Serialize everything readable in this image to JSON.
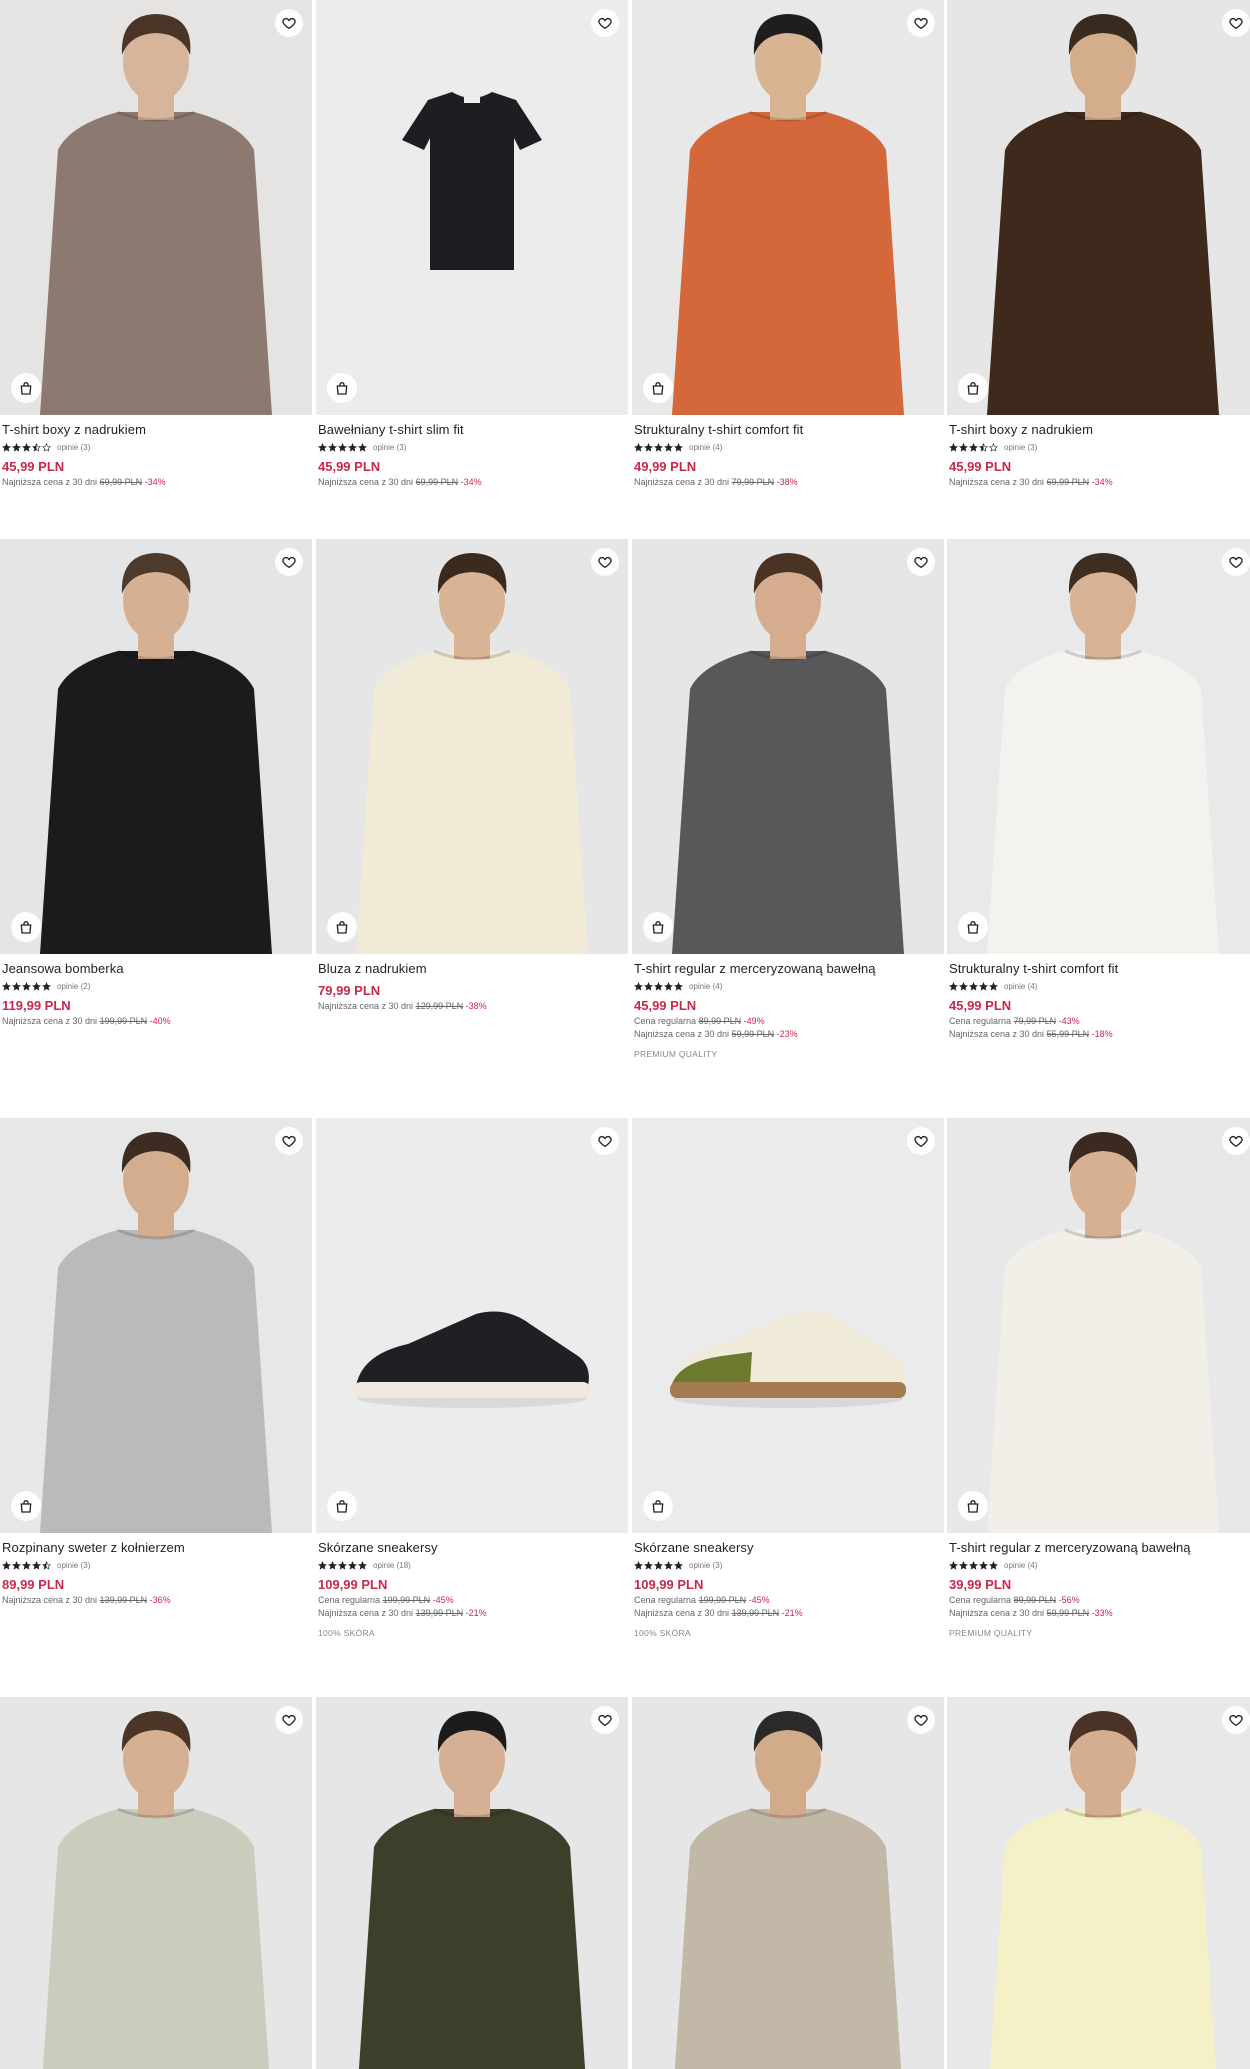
{
  "colors": {
    "price": "#c8284a",
    "text": "#222222",
    "muted": "#666666"
  },
  "icons": {
    "favorite": "heart-icon",
    "bag": "shopping-bag-icon",
    "star": "star-icon"
  },
  "products": [
    {
      "name": "T-shirt boxy z nadrukiem",
      "rating": 3.5,
      "reviews": "opinie (3)",
      "price": "45,99 PLN",
      "lines": [
        {
          "label": "Najniższa cena z 30 dni",
          "old": "69,99 PLN",
          "disc": "-34%"
        }
      ],
      "tag": "",
      "img": {
        "bg": "#e5e4e2",
        "type": "person",
        "garment": "#8c7a70",
        "skin": "#d7b59b",
        "hair": "#4a3526",
        "bottom": "#4c6d97"
      }
    },
    {
      "name": "Bawełniany t-shirt slim fit",
      "rating": 5,
      "reviews": "opinie (3)",
      "price": "45,99 PLN",
      "lines": [
        {
          "label": "Najniższa cena z 30 dni",
          "old": "69,99 PLN",
          "disc": "-34%"
        }
      ],
      "tag": "",
      "img": {
        "bg": "#ececec",
        "type": "flat",
        "garment": "#1c1e22"
      }
    },
    {
      "name": "Strukturalny t-shirt comfort fit",
      "rating": 5,
      "reviews": "opinie (4)",
      "price": "49,99 PLN",
      "lines": [
        {
          "label": "Najniższa cena z 30 dni",
          "old": "79,99 PLN",
          "disc": "-38%"
        }
      ],
      "tag": "",
      "img": {
        "bg": "#e8e8e8",
        "type": "person",
        "garment": "#d4683a",
        "skin": "#d9b493",
        "hair": "#1e1e1e",
        "bottom": "#3a5a85"
      }
    },
    {
      "name": "T-shirt boxy z nadrukiem",
      "rating": 3.5,
      "reviews": "opinie (3)",
      "price": "45,99 PLN",
      "lines": [
        {
          "label": "Najniższa cena z 30 dni",
          "old": "69,99 PLN",
          "disc": "-34%"
        }
      ],
      "tag": "",
      "img": {
        "bg": "#e6e6e6",
        "type": "person",
        "garment": "#3d2a1c",
        "skin": "#d4ad8c",
        "hair": "#3a2b20",
        "bottom": "#5f7ea8"
      }
    },
    {
      "name": "Jeansowa bomberka",
      "rating": 5,
      "reviews": "opinie (2)",
      "price": "119,99 PLN",
      "lines": [
        {
          "label": "Najniższa cena z 30 dni",
          "old": "199,99 PLN",
          "disc": "-40%"
        }
      ],
      "tag": "",
      "img": {
        "bg": "#e4e5e7",
        "type": "person",
        "garment": "#1b1b1d",
        "skin": "#d6b092",
        "hair": "#4d3a2b",
        "bottom": "#1b1b1d"
      }
    },
    {
      "name": "Bluza z nadrukiem",
      "rating": 0,
      "reviews": "",
      "price": "79,99 PLN",
      "lines": [
        {
          "label": "Najniższa cena z 30 dni",
          "old": "129,99 PLN",
          "disc": "-38%"
        }
      ],
      "tag": "",
      "img": {
        "bg": "#e6e6e6",
        "type": "person",
        "garment": "#f1ead6",
        "skin": "#d8b394",
        "hair": "#3b2a1e",
        "bottom": "#4b6b95"
      }
    },
    {
      "name": "T-shirt regular z merceryzowaną bawełną",
      "rating": 5,
      "reviews": "opinie (4)",
      "price": "45,99 PLN",
      "lines": [
        {
          "label": "Cena regularna",
          "old": "89,99 PLN",
          "disc": "-49%"
        },
        {
          "label": "Najniższa cena z 30 dni",
          "old": "59,99 PLN",
          "disc": "-23%"
        }
      ],
      "tag": "PREMIUM QUALITY",
      "img": {
        "bg": "#e6e6e6",
        "type": "person",
        "garment": "#58585a",
        "skin": "#d5ad8e",
        "hair": "#4a3324",
        "bottom": "#58585a"
      }
    },
    {
      "name": "Strukturalny t-shirt comfort fit",
      "rating": 5,
      "reviews": "opinie (4)",
      "price": "45,99 PLN",
      "lines": [
        {
          "label": "Cena regularna",
          "old": "79,99 PLN",
          "disc": "-43%"
        },
        {
          "label": "Najniższa cena z 30 dni",
          "old": "55,99 PLN",
          "disc": "-18%"
        }
      ],
      "tag": "",
      "img": {
        "bg": "#e9e9e9",
        "type": "person",
        "garment": "#f3f2ee",
        "skin": "#d7b294",
        "hair": "#3e2e22",
        "bottom": "#a9c0d9"
      }
    },
    {
      "name": "Rozpinany sweter z kołnierzem",
      "rating": 4.5,
      "reviews": "opinie (3)",
      "price": "89,99 PLN",
      "lines": [
        {
          "label": "Najniższa cena z 30 dni",
          "old": "139,99 PLN",
          "disc": "-36%"
        }
      ],
      "tag": "",
      "img": {
        "bg": "#e7e7e7",
        "type": "person",
        "garment": "#b9babc",
        "skin": "#d4ad8e",
        "hair": "#3c2c21",
        "bottom": "#2c3a4d"
      }
    },
    {
      "name": "Skórzane sneakersy",
      "rating": 5,
      "reviews": "opinie (18)",
      "price": "109,99 PLN",
      "lines": [
        {
          "label": "Cena regularna",
          "old": "199,99 PLN",
          "disc": "-45%"
        },
        {
          "label": "Najniższa cena z 30 dni",
          "old": "139,99 PLN",
          "disc": "-21%"
        }
      ],
      "tag": "100% SKÓRA",
      "img": {
        "bg": "#ececec",
        "type": "shoe",
        "garment": "#1f2023",
        "sole": "#efe9df"
      }
    },
    {
      "name": "Skórzane sneakersy",
      "rating": 5,
      "reviews": "opinie (3)",
      "price": "109,99 PLN",
      "lines": [
        {
          "label": "Cena regularna",
          "old": "199,99 PLN",
          "disc": "-45%"
        },
        {
          "label": "Najniższa cena z 30 dni",
          "old": "139,99 PLN",
          "disc": "-21%"
        }
      ],
      "tag": "100% SKÓRA",
      "img": {
        "bg": "#ebebeb",
        "type": "shoe",
        "garment": "#f0ead8",
        "sole": "#a77b52",
        "accent": "#6b7a2e"
      }
    },
    {
      "name": "T-shirt regular z merceryzowaną bawełną",
      "rating": 5,
      "reviews": "opinie (4)",
      "price": "39,99 PLN",
      "lines": [
        {
          "label": "Cena regularna",
          "old": "89,99 PLN",
          "disc": "-56%"
        },
        {
          "label": "Najniższa cena z 30 dni",
          "old": "59,99 PLN",
          "disc": "-33%"
        }
      ],
      "tag": "PREMIUM QUALITY",
      "img": {
        "bg": "#e8e8e8",
        "type": "person",
        "garment": "#f1efe8",
        "skin": "#d6b090",
        "hair": "#3a2a1f",
        "bottom": "#1e1e1e"
      }
    },
    {
      "name": "",
      "rating": 0,
      "reviews": "",
      "price": "",
      "lines": [],
      "tag": "",
      "img": {
        "bg": "#e6e6e6",
        "type": "person",
        "garment": "#c9cdbd",
        "skin": "#d6b092",
        "hair": "#4a3526",
        "bottom": "#c9cdbd"
      }
    },
    {
      "name": "",
      "rating": 0,
      "reviews": "",
      "price": "",
      "lines": [],
      "tag": "",
      "img": {
        "bg": "#e6e6e6",
        "type": "person",
        "garment": "#3d3f2a",
        "skin": "#d6b094",
        "hair": "#1c1c1c",
        "bottom": "#3d3f2a"
      }
    },
    {
      "name": "",
      "rating": 0,
      "reviews": "",
      "price": "",
      "lines": [],
      "tag": "",
      "img": {
        "bg": "#e6e6e6",
        "type": "person",
        "garment": "#c2b8a7",
        "skin": "#d2ab8b",
        "hair": "#2a2a2a",
        "bottom": "#c2b8a7"
      }
    },
    {
      "name": "",
      "rating": 0,
      "reviews": "",
      "price": "",
      "lines": [],
      "tag": "",
      "img": {
        "bg": "#e8e8e8",
        "type": "person",
        "garment": "#f4f0c8",
        "skin": "#d5ae8f",
        "hair": "#4a3324",
        "bottom": "#f4f0c8"
      }
    }
  ]
}
